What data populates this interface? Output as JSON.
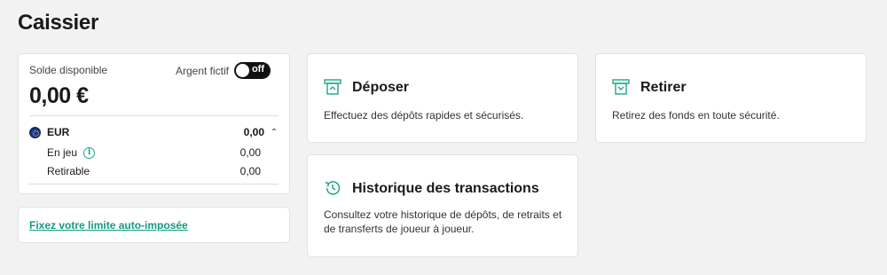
{
  "page": {
    "title": "Caissier"
  },
  "balance": {
    "label": "Solde disponible",
    "fake_money_label": "Argent fictif",
    "toggle_state": "off",
    "amount": "0,00 €",
    "currency": {
      "code": "EUR",
      "value": "0,00"
    },
    "rows": [
      {
        "label": "En jeu",
        "value": "0,00"
      },
      {
        "label": "Retirable",
        "value": "0,00"
      }
    ]
  },
  "limit": {
    "link_text": "Fixez votre limite auto-imposée"
  },
  "actions": {
    "deposit": {
      "title": "Déposer",
      "description": "Effectuez des dépôts rapides et sécurisés.",
      "icon": "deposit-icon"
    },
    "withdraw": {
      "title": "Retirer",
      "description": "Retirez des fonds en toute sécurité.",
      "icon": "withdraw-icon"
    },
    "history": {
      "title": "Historique des transactions",
      "description": "Consultez votre historique de dépôts, de retraits et de transferts de joueur à joueur.",
      "icon": "history-icon"
    }
  },
  "colors": {
    "accent": "#1fa58a",
    "link": "#139a82",
    "toggle": "#111111",
    "background": "#f2f2f2"
  }
}
